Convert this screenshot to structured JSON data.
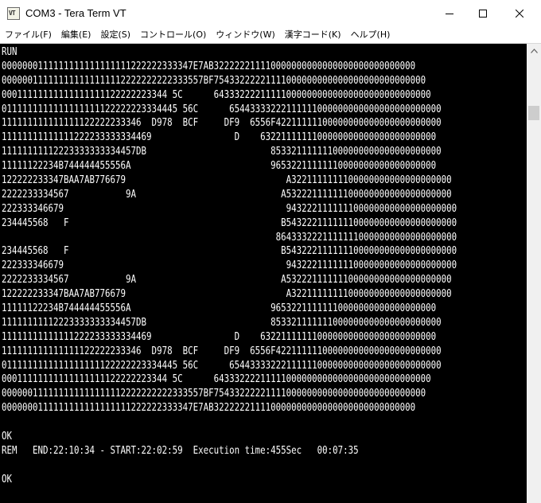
{
  "window": {
    "title": "COM3 - Tera Term VT",
    "icon_label": "VT"
  },
  "menu": {
    "items": [
      "ファイル(F)",
      "編集(E)",
      "設定(S)",
      "コントロール(O)",
      "ウィンドウ(W)",
      "漢字コード(K)",
      "ヘルプ(H)"
    ]
  },
  "icons": {
    "minimize": "minimize-icon",
    "maximize": "maximize-icon",
    "close": "close-icon",
    "scroll_up": "arrow-up-icon"
  },
  "colors": {
    "terminal_background": "#000000",
    "terminal_text": "#ffffff",
    "titlebar_background": "#ffffff",
    "scrollbar_track": "#f0f0f0",
    "scrollbar_thumb": "#cdcdcd"
  },
  "terminal": {
    "lines": [
      "RUN",
      "0000000111111111111111111222222333347E7AB322222211110000000000000000000000000000",
      "000000111111111111111112222222222333557BF75433222221111000000000000000000000000000",
      "00011111111111111111122222223344 5C      643332222111110000000000000000000000000000",
      "0111111111111111111122222223334445 56C      65443333222111111000000000000000000000000",
      "111111111111111122222233346  D978  BCF     DF9  6556F42211111100000000000000000000000",
      "11111111111111222233333334469                D    6322111111100000000000000000000000",
      "11111111112223333333334457DB                        853321111111000000000000000000000",
      "11111122234B744444455556A                           96532211111110000000000000000000",
      "122222233347BAA7AB776679                               A3221111111100000000000000000000",
      "2222233334567           9A                            A53222111111100000000000000000000",
      "222333346679                                           943222111111100000000000000000000",
      "234445568   F                                         B543222111111100000000000000000000",
      "                                                     86433322211111110000000000000000000",
      "234445568   F                                         B543222111111100000000000000000000",
      "222333346679                                           943222111111100000000000000000000",
      "2222233334567           9A                            A53222111111100000000000000000000",
      "122222233347BAA7AB776679                               A3221111111100000000000000000000",
      "11111122234B744444455556A                           96532211111110000000000000000000",
      "11111111112223333333334457DB                        853321111111000000000000000000000",
      "11111111111111222233333334469                D    6322111111100000000000000000000000",
      "111111111111111122222233346  D978  BCF     DF9  6556F42211111100000000000000000000000",
      "0111111111111111111122222223334445 56C      65443333222111111000000000000000000000000",
      "00011111111111111111122222223344 5C      643332222111110000000000000000000000000000",
      "000000111111111111111112222222222333557BF75433222221111000000000000000000000000000",
      "0000000111111111111111111222222333347E7AB322222211110000000000000000000000000000",
      "",
      "OK",
      "REM   END:22:10:34 - START:22:02:59  Execution time:455Sec   00:07:35",
      "",
      "OK"
    ]
  }
}
